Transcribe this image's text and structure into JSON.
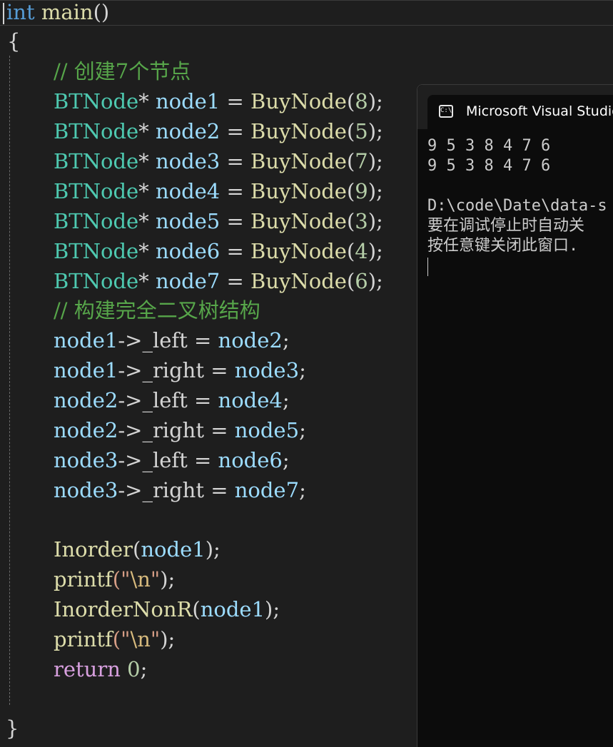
{
  "editor": {
    "lines": [
      [
        {
          "t": "int",
          "c": "kw"
        },
        {
          "t": " ",
          "c": "op"
        },
        {
          "t": "main",
          "c": "fn"
        },
        {
          "t": "()",
          "c": "op"
        }
      ],
      [
        {
          "t": "{",
          "c": "op"
        }
      ],
      [
        {
          "t": "// 创建7个节点",
          "c": "cmt"
        }
      ],
      [
        {
          "t": "BTNode",
          "c": "type"
        },
        {
          "t": "* ",
          "c": "op"
        },
        {
          "t": "node1",
          "c": "var"
        },
        {
          "t": " = ",
          "c": "op"
        },
        {
          "t": "BuyNode",
          "c": "fn"
        },
        {
          "t": "(",
          "c": "op"
        },
        {
          "t": "8",
          "c": "num"
        },
        {
          "t": ");",
          "c": "op"
        }
      ],
      [
        {
          "t": "BTNode",
          "c": "type"
        },
        {
          "t": "* ",
          "c": "op"
        },
        {
          "t": "node2",
          "c": "var"
        },
        {
          "t": " = ",
          "c": "op"
        },
        {
          "t": "BuyNode",
          "c": "fn"
        },
        {
          "t": "(",
          "c": "op"
        },
        {
          "t": "5",
          "c": "num"
        },
        {
          "t": ");",
          "c": "op"
        }
      ],
      [
        {
          "t": "BTNode",
          "c": "type"
        },
        {
          "t": "* ",
          "c": "op"
        },
        {
          "t": "node3",
          "c": "var"
        },
        {
          "t": " = ",
          "c": "op"
        },
        {
          "t": "BuyNode",
          "c": "fn"
        },
        {
          "t": "(",
          "c": "op"
        },
        {
          "t": "7",
          "c": "num"
        },
        {
          "t": ");",
          "c": "op"
        }
      ],
      [
        {
          "t": "BTNode",
          "c": "type"
        },
        {
          "t": "* ",
          "c": "op"
        },
        {
          "t": "node4",
          "c": "var"
        },
        {
          "t": " = ",
          "c": "op"
        },
        {
          "t": "BuyNode",
          "c": "fn"
        },
        {
          "t": "(",
          "c": "op"
        },
        {
          "t": "9",
          "c": "num"
        },
        {
          "t": ");",
          "c": "op"
        }
      ],
      [
        {
          "t": "BTNode",
          "c": "type"
        },
        {
          "t": "* ",
          "c": "op"
        },
        {
          "t": "node5",
          "c": "var"
        },
        {
          "t": " = ",
          "c": "op"
        },
        {
          "t": "BuyNode",
          "c": "fn"
        },
        {
          "t": "(",
          "c": "op"
        },
        {
          "t": "3",
          "c": "num"
        },
        {
          "t": ");",
          "c": "op"
        }
      ],
      [
        {
          "t": "BTNode",
          "c": "type"
        },
        {
          "t": "* ",
          "c": "op"
        },
        {
          "t": "node6",
          "c": "var"
        },
        {
          "t": " = ",
          "c": "op"
        },
        {
          "t": "BuyNode",
          "c": "fn"
        },
        {
          "t": "(",
          "c": "op"
        },
        {
          "t": "4",
          "c": "num"
        },
        {
          "t": ");",
          "c": "op"
        }
      ],
      [
        {
          "t": "BTNode",
          "c": "type"
        },
        {
          "t": "* ",
          "c": "op"
        },
        {
          "t": "node7",
          "c": "var"
        },
        {
          "t": " = ",
          "c": "op"
        },
        {
          "t": "BuyNode",
          "c": "fn"
        },
        {
          "t": "(",
          "c": "op"
        },
        {
          "t": "6",
          "c": "num"
        },
        {
          "t": ");",
          "c": "op"
        }
      ],
      [
        {
          "t": "// 构建完全二叉树结构",
          "c": "cmt"
        }
      ],
      [
        {
          "t": "node1",
          "c": "var"
        },
        {
          "t": "->",
          "c": "op"
        },
        {
          "t": "_left",
          "c": "op"
        },
        {
          "t": " = ",
          "c": "op"
        },
        {
          "t": "node2",
          "c": "var"
        },
        {
          "t": ";",
          "c": "op"
        }
      ],
      [
        {
          "t": "node1",
          "c": "var"
        },
        {
          "t": "->",
          "c": "op"
        },
        {
          "t": "_right",
          "c": "op"
        },
        {
          "t": " = ",
          "c": "op"
        },
        {
          "t": "node3",
          "c": "var"
        },
        {
          "t": ";",
          "c": "op"
        }
      ],
      [
        {
          "t": "node2",
          "c": "var"
        },
        {
          "t": "->",
          "c": "op"
        },
        {
          "t": "_left",
          "c": "op"
        },
        {
          "t": " = ",
          "c": "op"
        },
        {
          "t": "node4",
          "c": "var"
        },
        {
          "t": ";",
          "c": "op"
        }
      ],
      [
        {
          "t": "node2",
          "c": "var"
        },
        {
          "t": "->",
          "c": "op"
        },
        {
          "t": "_right",
          "c": "op"
        },
        {
          "t": " = ",
          "c": "op"
        },
        {
          "t": "node5",
          "c": "var"
        },
        {
          "t": ";",
          "c": "op"
        }
      ],
      [
        {
          "t": "node3",
          "c": "var"
        },
        {
          "t": "->",
          "c": "op"
        },
        {
          "t": "_left",
          "c": "op"
        },
        {
          "t": " = ",
          "c": "op"
        },
        {
          "t": "node6",
          "c": "var"
        },
        {
          "t": ";",
          "c": "op"
        }
      ],
      [
        {
          "t": "node3",
          "c": "var"
        },
        {
          "t": "->",
          "c": "op"
        },
        {
          "t": "_right",
          "c": "op"
        },
        {
          "t": " = ",
          "c": "op"
        },
        {
          "t": "node7",
          "c": "var"
        },
        {
          "t": ";",
          "c": "op"
        }
      ],
      [],
      [
        {
          "t": "Inorder",
          "c": "fn"
        },
        {
          "t": "(",
          "c": "op"
        },
        {
          "t": "node1",
          "c": "var"
        },
        {
          "t": ");",
          "c": "op"
        }
      ],
      [
        {
          "t": "printf",
          "c": "fn"
        },
        {
          "t": "(\"",
          "c": "str"
        },
        {
          "t": "\\n",
          "c": "esc"
        },
        {
          "t": "\"",
          "c": "str"
        },
        {
          "t": ");",
          "c": "op"
        }
      ],
      [
        {
          "t": "InorderNonR",
          "c": "fn"
        },
        {
          "t": "(",
          "c": "op"
        },
        {
          "t": "node1",
          "c": "var"
        },
        {
          "t": ");",
          "c": "op"
        }
      ],
      [
        {
          "t": "printf",
          "c": "fn"
        },
        {
          "t": "(\"",
          "c": "str"
        },
        {
          "t": "\\n",
          "c": "esc"
        },
        {
          "t": "\"",
          "c": "str"
        },
        {
          "t": ");",
          "c": "op"
        }
      ],
      [
        {
          "t": "return",
          "c": "ret"
        },
        {
          "t": " ",
          "c": "op"
        },
        {
          "t": "0",
          "c": "num"
        },
        {
          "t": ";",
          "c": "op"
        }
      ],
      [],
      [
        {
          "t": "}",
          "c": "op"
        }
      ]
    ]
  },
  "console": {
    "title": "Microsoft Visual Studio",
    "icon": "terminal-icon",
    "icon_text": "C:\\",
    "output": [
      "9 5 3 8 4 7 6",
      "9 5 3 8 4 7 6",
      "D:\\code\\Date\\data-s",
      "要在调试停止时自动关",
      "按任意键关闭此窗口."
    ]
  },
  "colors": {
    "background": "#1e1e1e",
    "keyword": "#569cd6",
    "function": "#dcdcaa",
    "type": "#4ec9b0",
    "variable": "#9cdcfe",
    "number": "#b5cea8",
    "comment": "#57a64a",
    "return": "#d8a0df",
    "console_bg": "#0c0c0c"
  }
}
